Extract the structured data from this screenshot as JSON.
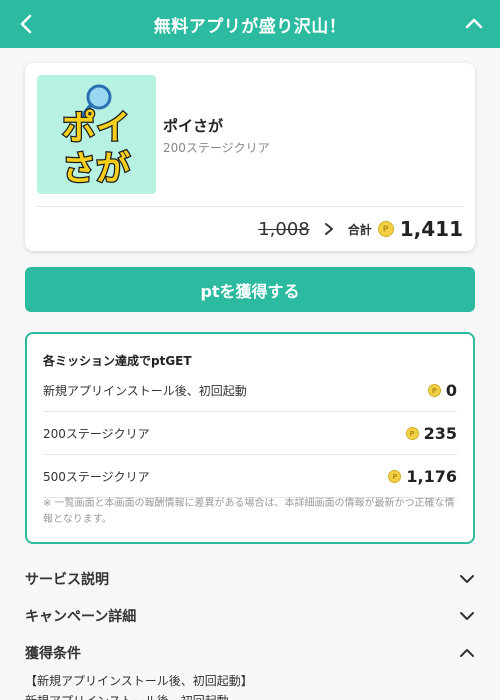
{
  "header": {
    "title": "無料アプリが盛り沢山！"
  },
  "app": {
    "name": "ポイさが",
    "subtitle": "200ステージクリア",
    "logo_top": "ポイ",
    "logo_bottom": "さが"
  },
  "points": {
    "old": "1,008",
    "total_label": "合計",
    "total": "1,411"
  },
  "cta": {
    "label": "ptを獲得する"
  },
  "missions": {
    "title": "各ミッション達成でptGET",
    "items": [
      {
        "label": "新規アプリインストール後、初回起動",
        "points": "0"
      },
      {
        "label": "200ステージクリア",
        "points": "235"
      },
      {
        "label": "500ステージクリア",
        "points": "1,176"
      }
    ],
    "notice": "※ 一覧画面と本画面の報酬情報に差異がある場合は、本詳細画面の情報が最新かつ正確な情報となります。"
  },
  "sections": {
    "service": "サービス説明",
    "campaign": "キャンペーン詳細",
    "conditions": "獲得条件"
  },
  "conditions_text": {
    "line1": "【新規アプリインストール後、初回起動】",
    "line2": "新規アプリインストール後、初回起動"
  },
  "colors": {
    "accent": "#2cbba0",
    "coin": "#f2d046",
    "logo_bg": "#b6f1e2"
  }
}
